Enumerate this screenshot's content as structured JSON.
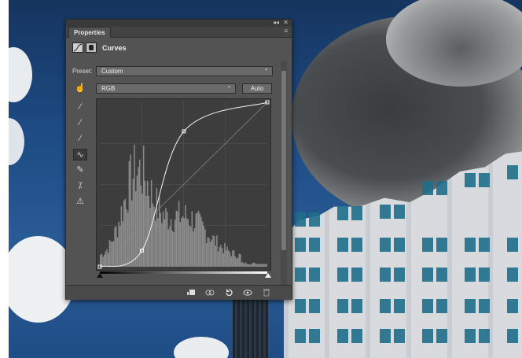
{
  "panel": {
    "window_controls": {
      "collapse": "◂◂",
      "close": "✕"
    },
    "tab_label": "Properties",
    "menu_glyph": "≡",
    "adjustment_title": "Curves",
    "preset_label": "Preset:",
    "preset_value": "Custom",
    "channel_value": "RGB",
    "auto_label": "Auto",
    "tools": [
      {
        "name": "on-image-adjust-icon",
        "glyph": "☝"
      },
      {
        "name": "black-point-eyedropper-icon",
        "glyph": "⁄"
      },
      {
        "name": "gray-point-eyedropper-icon",
        "glyph": "⁄"
      },
      {
        "name": "white-point-eyedropper-icon",
        "glyph": "⁄"
      },
      {
        "name": "curve-points-tool-icon",
        "glyph": "∿"
      },
      {
        "name": "pencil-tool-icon",
        "glyph": "✎"
      },
      {
        "name": "smooth-curve-icon",
        "glyph": "⁒"
      },
      {
        "name": "clipping-warning-icon",
        "glyph": "⚠"
      }
    ],
    "curve_points": [
      [
        0,
        0
      ],
      [
        64,
        25
      ],
      [
        128,
        210
      ],
      [
        255,
        255
      ]
    ],
    "bottom_icons": [
      "clip-to-layer-icon",
      "view-previous-state-icon",
      "reset-icon",
      "visibility-icon",
      "delete-icon"
    ],
    "colors": {
      "panel_bg": "#535353",
      "graph_bg": "#3d3d3d",
      "histogram": "#9a9a9a",
      "curve": "#f2f2f2"
    }
  }
}
